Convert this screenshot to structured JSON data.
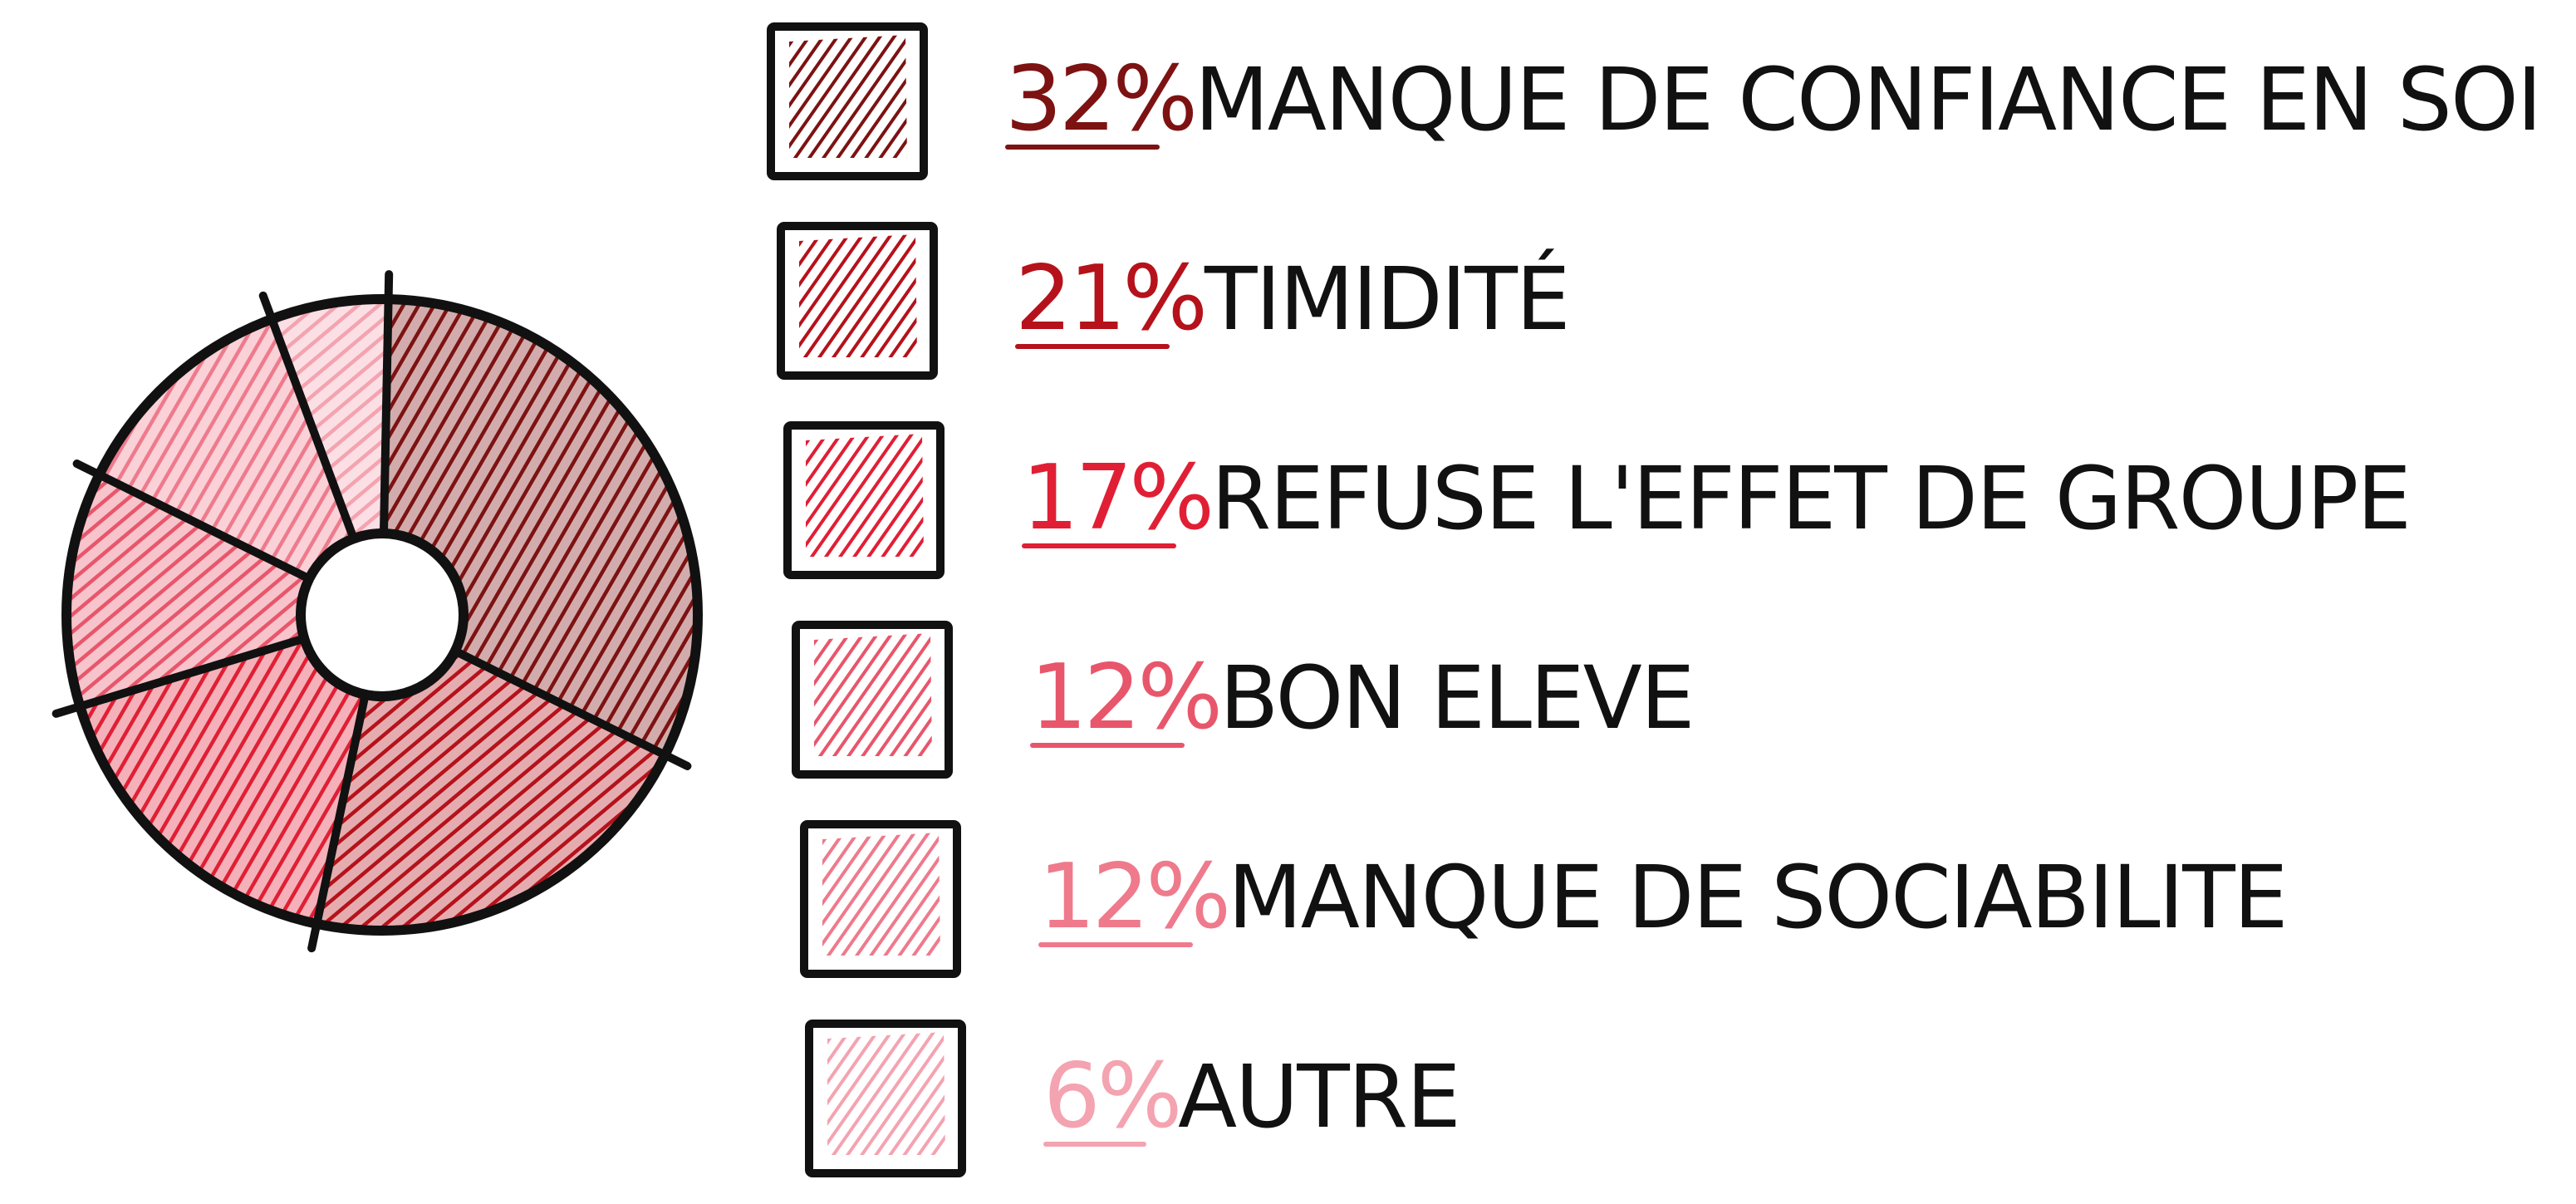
{
  "chart_data": {
    "type": "pie",
    "style": "hand-drawn donut chart with hatched fills",
    "categories": [
      "MANQUE DE CONFIANCE EN SOI",
      "TIMIDITÉ",
      "REFUSE L'EFFET DE GROUPE",
      "BON ELEVE",
      "MANQUE DE SOCIABILITE",
      "AUTRE"
    ],
    "values": [
      32,
      21,
      17,
      12,
      12,
      6
    ],
    "value_labels": [
      "32%",
      "21%",
      "17%",
      "12%",
      "12%",
      "6%"
    ],
    "colors": [
      "#7d1212",
      "#b5121b",
      "#e01f35",
      "#e8566b",
      "#ee7a8c",
      "#f4a3b0"
    ],
    "legend_position": "right"
  }
}
